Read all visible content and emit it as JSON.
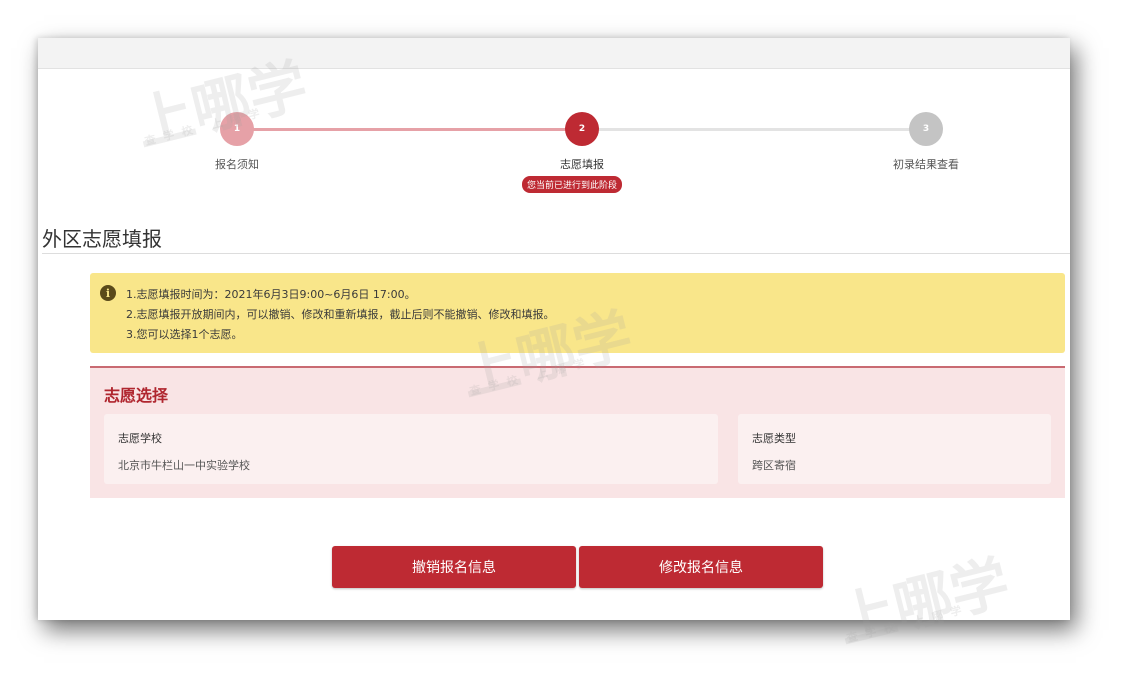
{
  "stepper": {
    "steps": [
      {
        "number": "1",
        "label": "报名须知"
      },
      {
        "number": "2",
        "label": "志愿填报"
      },
      {
        "number": "3",
        "label": "初录结果查看"
      }
    ],
    "current_badge": "您当前已进行到此阶段"
  },
  "page": {
    "title": "外区志愿填报"
  },
  "notice": {
    "icon": "info-icon",
    "lines": [
      "1.志愿填报时间为：2021年6月3日9:00~6月6日 17:00。",
      "2.志愿填报开放期间内，可以撤销、修改和重新填报，截止后则不能撤销、修改和填报。",
      "3.您可以选择1个志愿。"
    ]
  },
  "choice": {
    "title": "志愿选择",
    "school_label": "志愿学校",
    "school_value": "北京市牛栏山一中实验学校",
    "type_label": "志愿类型",
    "type_value": "跨区寄宿"
  },
  "actions": {
    "cancel_label": "撤销报名信息",
    "modify_label": "修改报名信息"
  },
  "watermark": {
    "brand": "上哪学",
    "sub": "查学校 上哪学"
  },
  "colors": {
    "primary": "#be2a33",
    "notice_bg": "#f9e68a",
    "panel_bg": "#f9e4e5"
  }
}
